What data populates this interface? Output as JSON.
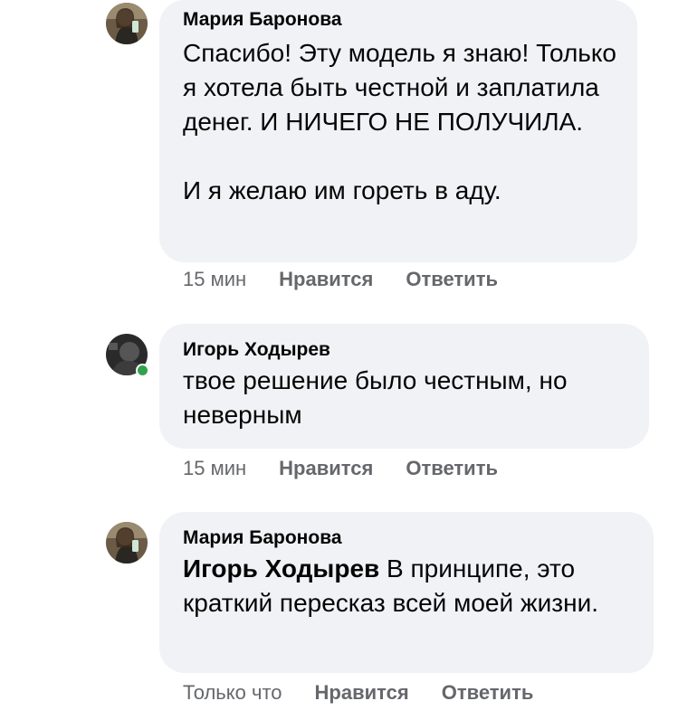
{
  "comments": [
    {
      "author": "Мария Баронова",
      "text": "Спасибо! Эту модель я знаю! Только я хотела быть честной и заплатила денег. И НИЧЕГО НЕ ПОЛУЧИЛА.\n\nИ я желаю им гореть в аду.",
      "time": "15 мин",
      "like_label": "Нравится",
      "reply_label": "Ответить"
    },
    {
      "author": "Игорь Ходырев",
      "text": "твое решение было честным, но неверным",
      "time": "15 мин",
      "like_label": "Нравится",
      "reply_label": "Ответить",
      "online": true
    },
    {
      "author": "Мария Баронова",
      "mention": "Игорь Ходырев",
      "text": " В принципе, это краткий пересказ всей моей жизни.",
      "time": "Только что",
      "like_label": "Нравится",
      "reply_label": "Ответить"
    }
  ],
  "colors": {
    "bubble": "#f0f2f5",
    "meta_text": "#65676b",
    "online": "#31a24c"
  }
}
